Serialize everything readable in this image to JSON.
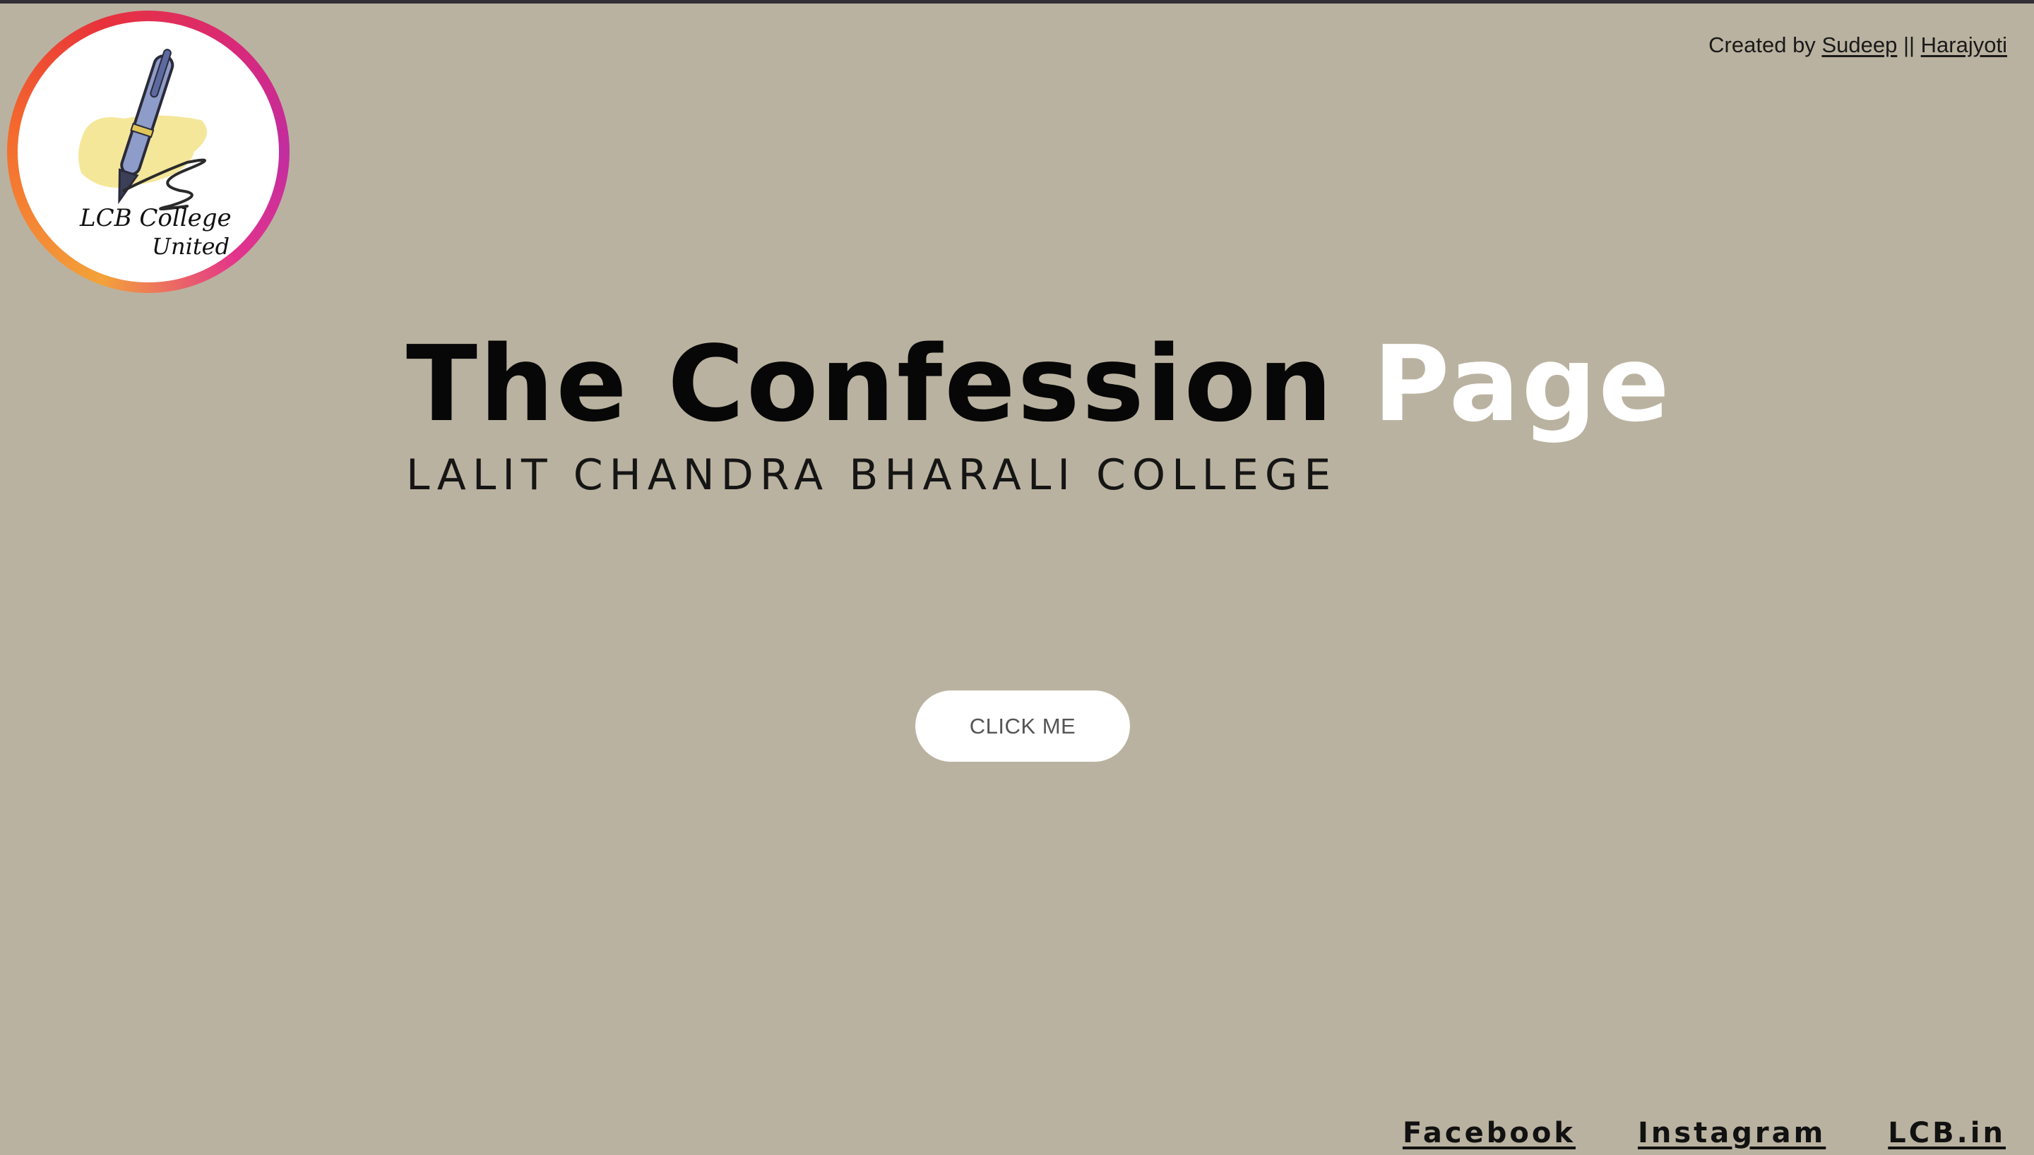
{
  "logo": {
    "text_line1": "LCB College",
    "text_line2": "United",
    "ring_colors": [
      "#f3a23a",
      "#e8323a",
      "#c22da0"
    ]
  },
  "credits": {
    "prefix": "Created by ",
    "author1": "Sudeep",
    "separator": " || ",
    "author2": "Harajyoti"
  },
  "hero": {
    "title_dark": "The Confession ",
    "title_light": "Page",
    "subtitle": "LALIT CHANDRA BHARALI COLLEGE"
  },
  "cta": {
    "label": "CLICK ME"
  },
  "footer": {
    "links": [
      "Facebook",
      "Instagram",
      "LCB.in"
    ]
  },
  "colors": {
    "background": "#bab2a0",
    "top_bar": "#322f37",
    "title_dark": "#070707",
    "title_light": "#ffffff",
    "button_bg": "#ffffff",
    "button_text": "#555555"
  }
}
